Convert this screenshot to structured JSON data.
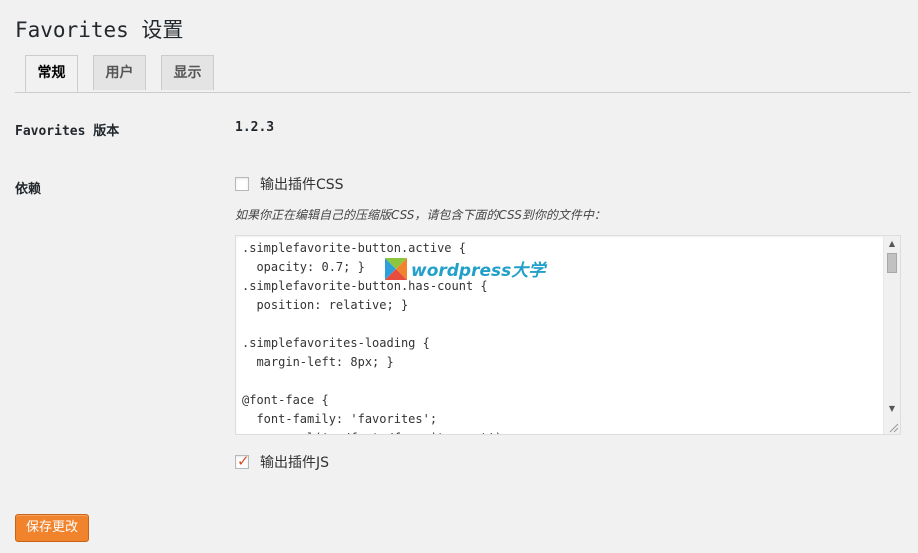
{
  "page": {
    "title": "Favorites 设置"
  },
  "tabs": [
    {
      "label": "常规",
      "active": true
    },
    {
      "label": "用户",
      "active": false
    },
    {
      "label": "显示",
      "active": false
    }
  ],
  "version_row": {
    "label": "Favorites 版本",
    "value": "1.2.3"
  },
  "dependencies_row": {
    "label": "依赖",
    "output_css": {
      "label": "输出插件CSS",
      "checked": false
    },
    "description": "如果你正在编辑自己的压缩版CSS，请包含下面的CSS到你的文件中：",
    "css_code": ".simplefavorite-button.active {\n  opacity: 0.7; }\n.simplefavorite-button.has-count {\n  position: relative; }\n\n.simplefavorites-loading {\n  margin-left: 8px; }\n\n@font-face {\n  font-family: 'favorites';\n  src: url('../fonts/favorites.eot');",
    "output_js": {
      "label": "输出插件JS",
      "checked": true
    }
  },
  "watermark": {
    "text": "wordpress大学"
  },
  "save_button": {
    "label": "保存更改"
  },
  "colors": {
    "accent": "#f0832c",
    "check": "#d54e21",
    "background": "#f1f1f1"
  }
}
